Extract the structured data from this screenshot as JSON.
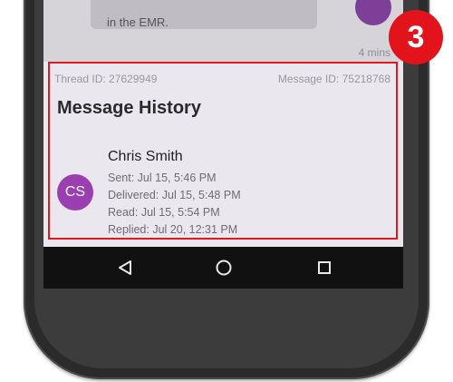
{
  "previous_message": {
    "text": "in the EMR.",
    "time": "4 mins"
  },
  "history": {
    "thread_id": "Thread ID: 27629949",
    "message_id": "Message ID: 75218768",
    "title": "Message History",
    "contact": {
      "initials": "CS",
      "name": "Chris Smith",
      "sent": "Sent:  Jul 15, 5:46 PM",
      "delivered": "Delivered:  Jul 15, 5:48 PM",
      "read": "Read:  Jul 15, 5:54 PM",
      "replied": "Replied:  Jul 20, 12:31 PM"
    }
  },
  "navbar": {
    "back_icon": "back-triangle-icon",
    "home_icon": "home-circle-icon",
    "recents_icon": "recents-square-icon"
  },
  "step_badge": "3",
  "colors": {
    "highlight": "#e0191f",
    "badge": "#e3131b",
    "avatar": "#9b3fb0",
    "screen_bg": "#eae7ee",
    "navbar_bg": "#111111"
  }
}
